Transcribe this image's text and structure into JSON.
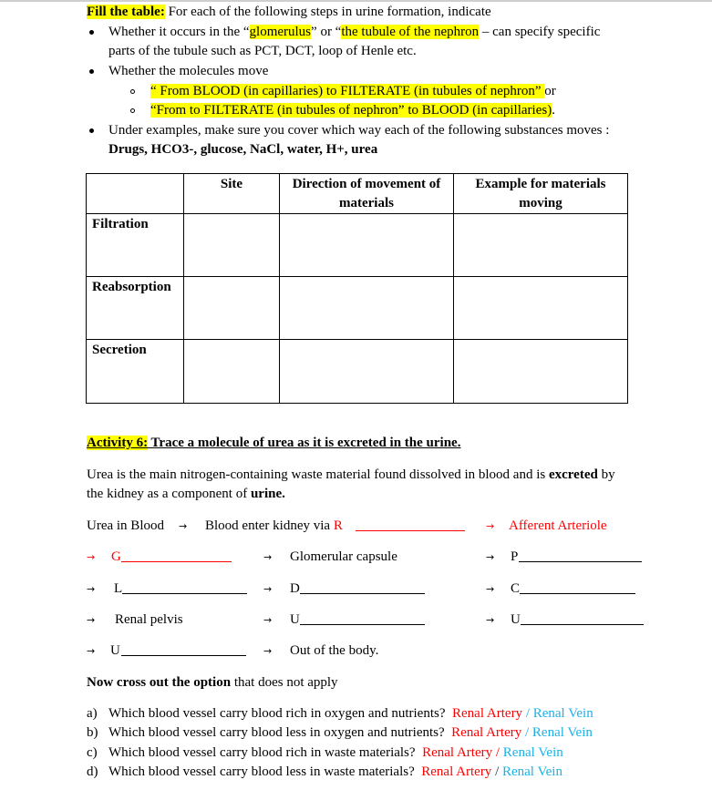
{
  "instructions": {
    "heading": "Fill the table:",
    "intro": " For each of the following steps in urine formation, indicate",
    "bullet1": {
      "pre": "Whether it occurs in the “",
      "hl1": "glomerulus",
      "mid": "” or “",
      "hl2": "the tubule of the nephron",
      "post": " – can specify specific",
      "line2": "parts of the tubule such as PCT, DCT, loop of Henle etc."
    },
    "bullet2": {
      "text": "Whether the molecules move",
      "sub1": "“ From BLOOD (in capillaries) to FILTERATE (in tubules of nephron” ",
      "sub1_post": " or",
      "sub2": "“From to FILTERATE (in tubules of nephron” to BLOOD (in capillaries)",
      "sub2_post": "."
    },
    "bullet3": {
      "text": "Under examples, make sure you cover which way each of the following substances moves :",
      "substances": "Drugs, HCO3-, glucose, NaCl, water, H+, urea"
    }
  },
  "table": {
    "headers": [
      "",
      "Site",
      "Direction of movement of materials",
      "Example for materials moving"
    ],
    "header_lines": {
      "site": "Site",
      "direction_l1": "Direction of movement of",
      "direction_l2": "materials",
      "example_l1": "Example for materials",
      "example_l2": "moving"
    },
    "rows": [
      {
        "label": "Filtration",
        "site": "",
        "direction": "",
        "example": ""
      },
      {
        "label": "Reabsorption",
        "site": "",
        "direction": "",
        "example": ""
      },
      {
        "label": "Secretion",
        "site": "",
        "direction": "",
        "example": ""
      }
    ]
  },
  "activity": {
    "label": "Activity 6:",
    "title": " Trace a molecule of urea as it is excreted in the urine.",
    "para_pre": "Urea is the main nitrogen-containing waste material found dissolved in blood and is ",
    "para_bold1": "excreted",
    "para_mid": " by",
    "para_line2_pre": "the kidney as a component of ",
    "para_bold2": "urine."
  },
  "trace": {
    "arrow": "→",
    "start": "Urea in Blood",
    "step_blood_enter": "Blood enter kidney via ",
    "r_letter": "R",
    "afferent": "Afferent Arteriole",
    "g_letter": "G",
    "glomerular_capsule": "Glomerular capsule",
    "p_letter": "P",
    "l_letter": "L",
    "d_letter": "D",
    "c_letter": "C",
    "renal_pelvis": "Renal pelvis",
    "u_letter": "U",
    "out_of_body": "Out of the body."
  },
  "cross_out": {
    "heading_bold": "Now cross out the option",
    "heading_rest": " that does not apply",
    "option_artery": "Renal Artery",
    "option_vein": "Renal Vein",
    "slash": "/",
    "questions": [
      {
        "letter": "a)",
        "text": "Which blood vessel carry blood rich in oxygen and nutrients?"
      },
      {
        "letter": "b)",
        "text": "Which blood vessel carry blood less in oxygen and nutrients?"
      },
      {
        "letter": "c)",
        "text": "Which blood vessel carry blood rich in waste materials?"
      },
      {
        "letter": "d)",
        "text": "Which blood vessel carry blood less in waste materials?"
      }
    ]
  },
  "colors": {
    "highlight": "#ffff00",
    "artery_red": "#ff0000",
    "vein_blue": "#1ab2e8"
  }
}
